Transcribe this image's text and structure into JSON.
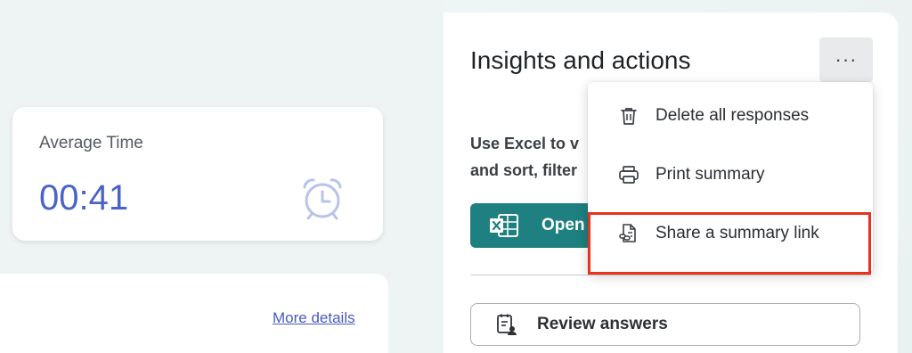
{
  "average_time": {
    "label": "Average Time",
    "value": "00:41",
    "icon": "alarm-clock-icon"
  },
  "details": {
    "more_details_link": "More details"
  },
  "insights": {
    "title": "Insights and actions",
    "more_button_label": "···",
    "description_line1": "Use Excel to v",
    "description_line2": "and sort, filter",
    "open_excel_label": "Open",
    "review_answers_label": "Review answers"
  },
  "menu": {
    "items": [
      {
        "label": "Delete all responses",
        "icon": "trash-icon"
      },
      {
        "label": "Print summary",
        "icon": "printer-icon"
      },
      {
        "label": "Share a summary link",
        "icon": "share-link-icon"
      }
    ]
  },
  "colors": {
    "accent_blue": "#4a63c8",
    "excel_green": "#1e8080",
    "highlight_red": "#e8321e"
  }
}
